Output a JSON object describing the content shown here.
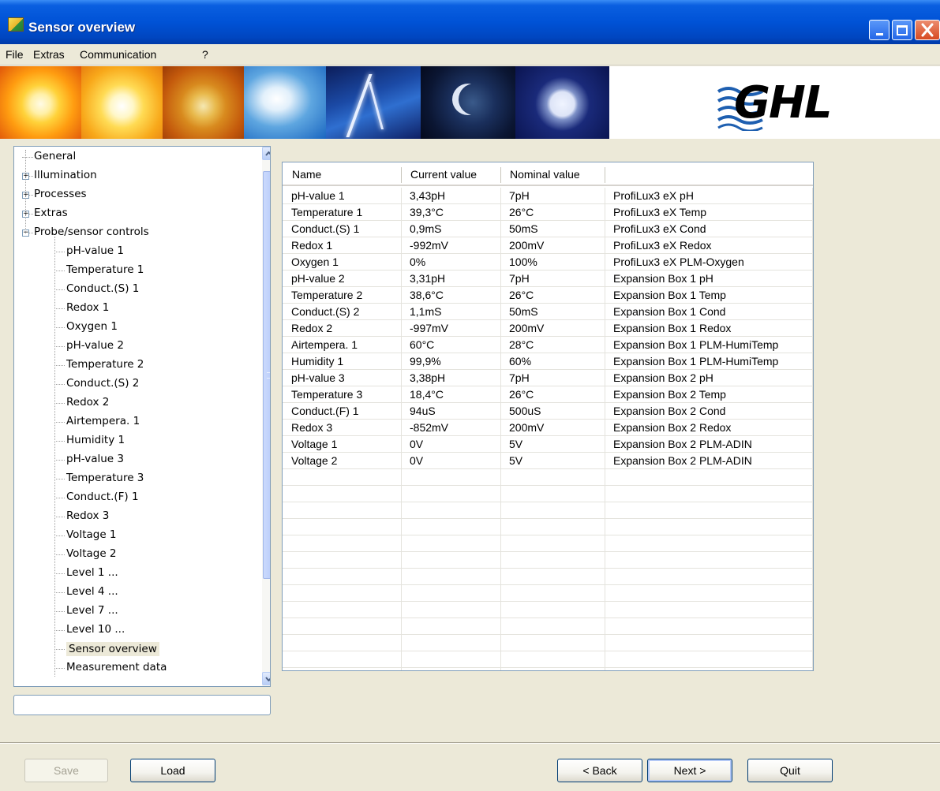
{
  "window": {
    "title": "Sensor overview"
  },
  "menu": {
    "file": "File",
    "extras": "Extras",
    "communication": "Communication",
    "help": "?"
  },
  "banner": {
    "logo_text": "GHL"
  },
  "tree": {
    "nodes": [
      {
        "label": "General",
        "expander": "",
        "level": 0
      },
      {
        "label": "Illumination",
        "expander": "+",
        "level": 0
      },
      {
        "label": "Processes",
        "expander": "+",
        "level": 0
      },
      {
        "label": "Extras",
        "expander": "+",
        "level": 0
      },
      {
        "label": "Probe/sensor controls",
        "expander": "−",
        "level": 0
      },
      {
        "label": "pH-value 1",
        "expander": "",
        "level": 1
      },
      {
        "label": "Temperature 1",
        "expander": "",
        "level": 1
      },
      {
        "label": "Conduct.(S) 1",
        "expander": "",
        "level": 1
      },
      {
        "label": "Redox 1",
        "expander": "",
        "level": 1
      },
      {
        "label": "Oxygen 1",
        "expander": "",
        "level": 1
      },
      {
        "label": "pH-value 2",
        "expander": "",
        "level": 1
      },
      {
        "label": "Temperature 2",
        "expander": "",
        "level": 1
      },
      {
        "label": "Conduct.(S) 2",
        "expander": "",
        "level": 1
      },
      {
        "label": "Redox 2",
        "expander": "",
        "level": 1
      },
      {
        "label": "Airtempera. 1",
        "expander": "",
        "level": 1
      },
      {
        "label": "Humidity 1",
        "expander": "",
        "level": 1
      },
      {
        "label": "pH-value 3",
        "expander": "",
        "level": 1
      },
      {
        "label": "Temperature 3",
        "expander": "",
        "level": 1
      },
      {
        "label": "Conduct.(F) 1",
        "expander": "",
        "level": 1
      },
      {
        "label": "Redox 3",
        "expander": "",
        "level": 1
      },
      {
        "label": "Voltage 1",
        "expander": "",
        "level": 1
      },
      {
        "label": "Voltage 2",
        "expander": "",
        "level": 1
      },
      {
        "label": "Level 1 ...",
        "expander": "",
        "level": 1
      },
      {
        "label": "Level 4 ...",
        "expander": "",
        "level": 1
      },
      {
        "label": "Level 7 ...",
        "expander": "",
        "level": 1
      },
      {
        "label": "Level 10 ...",
        "expander": "",
        "level": 1
      },
      {
        "label": "Sensor overview",
        "expander": "",
        "level": 1,
        "selected": true
      },
      {
        "label": "Measurement data",
        "expander": "",
        "level": 1
      }
    ]
  },
  "status_field": {
    "value": ""
  },
  "table": {
    "columns": [
      "Name",
      "Current value",
      "Nominal value",
      ""
    ],
    "rows": [
      [
        "pH-value 1",
        "3,43pH",
        "7pH",
        "ProfiLux3 eX pH"
      ],
      [
        "Temperature 1",
        "39,3°C",
        "26°C",
        "ProfiLux3 eX Temp"
      ],
      [
        "Conduct.(S) 1",
        "0,9mS",
        "50mS",
        "ProfiLux3 eX Cond"
      ],
      [
        "Redox 1",
        "-992mV",
        "200mV",
        "ProfiLux3 eX Redox"
      ],
      [
        "Oxygen 1",
        "0%",
        "100%",
        "ProfiLux3 eX PLM-Oxygen"
      ],
      [
        "pH-value 2",
        "3,31pH",
        "7pH",
        "Expansion Box 1 pH"
      ],
      [
        "Temperature 2",
        "38,6°C",
        "26°C",
        "Expansion Box 1 Temp"
      ],
      [
        "Conduct.(S) 2",
        "1,1mS",
        "50mS",
        "Expansion Box 1 Cond"
      ],
      [
        "Redox 2",
        "-997mV",
        "200mV",
        "Expansion Box 1 Redox"
      ],
      [
        "Airtempera. 1",
        "60°C",
        "28°C",
        "Expansion Box 1 PLM-HumiTemp"
      ],
      [
        "Humidity 1",
        "99,9%",
        "60%",
        "Expansion Box 1 PLM-HumiTemp"
      ],
      [
        "pH-value 3",
        "3,38pH",
        "7pH",
        "Expansion Box 2 pH"
      ],
      [
        "Temperature 3",
        "18,4°C",
        "26°C",
        "Expansion Box 2 Temp"
      ],
      [
        "Conduct.(F) 1",
        "94uS",
        "500uS",
        "Expansion Box 2 Cond"
      ],
      [
        "Redox 3",
        "-852mV",
        "200mV",
        "Expansion Box 2 Redox"
      ],
      [
        "Voltage 1",
        "0V",
        "5V",
        "Expansion Box 2 PLM-ADIN"
      ],
      [
        "Voltage 2",
        "0V",
        "5V",
        "Expansion Box 2 PLM-ADIN"
      ]
    ],
    "empty_rows": 12
  },
  "buttons": {
    "save": "Save",
    "load": "Load",
    "back": "< Back",
    "next": "Next >",
    "quit": "Quit"
  },
  "icons": {
    "app": "app-icon",
    "minimize": "minimize-icon",
    "maximize": "maximize-icon",
    "close": "close-icon",
    "scroll_up": "chevron-up-icon",
    "scroll_down": "chevron-down-icon"
  }
}
